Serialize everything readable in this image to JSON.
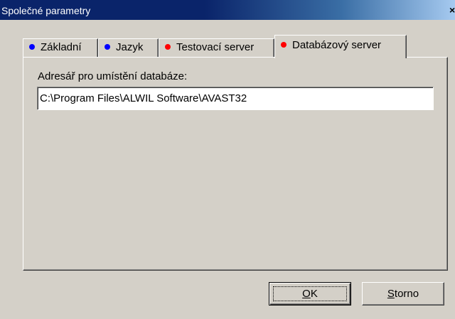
{
  "window": {
    "title": "Společné parametry",
    "close_glyph": "×"
  },
  "tabs": [
    {
      "label": "Základní",
      "dot_color": "#0000ff",
      "active": false
    },
    {
      "label": "Jazyk",
      "dot_color": "#0000ff",
      "active": false
    },
    {
      "label": "Testovací server",
      "dot_color": "#ff0000",
      "active": false
    },
    {
      "label": "Databázový server",
      "dot_color": "#ff0000",
      "active": true
    }
  ],
  "panel": {
    "field_label": "Adresář pro umístění databáze:",
    "path_value": "C:\\Program Files\\ALWIL Software\\AVAST32"
  },
  "buttons": {
    "ok_mnemonic": "O",
    "ok_rest": "K",
    "cancel_mnemonic": "S",
    "cancel_rest": "torno"
  }
}
